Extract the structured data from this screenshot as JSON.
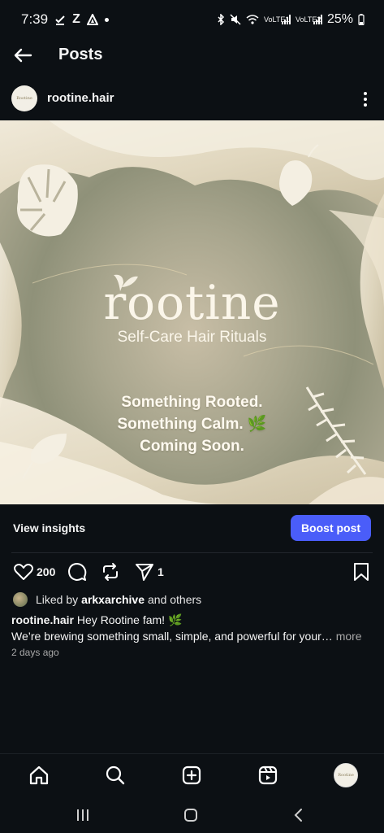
{
  "status_bar": {
    "time": "7:39",
    "indicators": [
      "Z"
    ],
    "network_label_1": "VoLTE1",
    "network_label_2": "VoLTE2",
    "battery": "25%"
  },
  "header": {
    "title": "Posts"
  },
  "post": {
    "username": "rootine.hair",
    "avatar_text": "Rootine",
    "image": {
      "brand_name": "rootine",
      "brand_subtitle": "Self-Care Hair Rituals",
      "teaser_lines": [
        "Something Rooted.",
        "Something Calm. 🌿",
        "Coming Soon."
      ]
    },
    "view_insights_label": "View insights",
    "boost_label": "Boost post",
    "likes_count": "200",
    "shares_count": "1",
    "liked_by_prefix": "Liked by",
    "liked_by_user": "arkxarchive",
    "liked_by_suffix": "and others",
    "caption_user": "rootine.hair",
    "caption_text": "Hey Rootine fam! 🌿",
    "caption_line2": "We’re brewing something small, simple, and powerful for your…",
    "more_label": "more",
    "timestamp": "2 days ago"
  },
  "colors": {
    "background": "#0c1014",
    "boost_button": "#4a5df9",
    "muted_text": "#a8a8a8"
  }
}
